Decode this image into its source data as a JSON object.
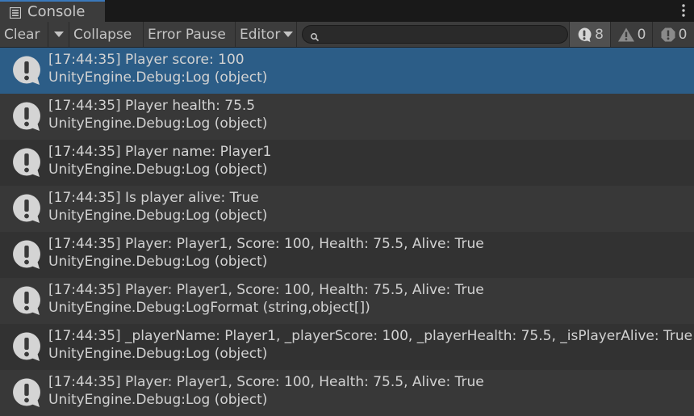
{
  "tab": {
    "label": "Console",
    "icon": "console-list-icon"
  },
  "toolbar": {
    "clear_label": "Clear",
    "collapse_label": "Collapse",
    "error_pause_label": "Error Pause",
    "editor_label": "Editor",
    "search_value": "",
    "counts": {
      "info": "8",
      "warning": "0",
      "error": "0"
    }
  },
  "logs": [
    {
      "line1": "[17:44:35] Player score: 100",
      "line2": "UnityEngine.Debug:Log (object)"
    },
    {
      "line1": "[17:44:35] Player health: 75.5",
      "line2": "UnityEngine.Debug:Log (object)"
    },
    {
      "line1": "[17:44:35] Player name: Player1",
      "line2": "UnityEngine.Debug:Log (object)"
    },
    {
      "line1": "[17:44:35] Is player alive: True",
      "line2": "UnityEngine.Debug:Log (object)"
    },
    {
      "line1": "[17:44:35] Player: Player1, Score: 100, Health: 75.5, Alive: True",
      "line2": "UnityEngine.Debug:Log (object)"
    },
    {
      "line1": "[17:44:35] Player: Player1, Score: 100, Health: 75.5, Alive: True",
      "line2": "UnityEngine.Debug:LogFormat (string,object[])"
    },
    {
      "line1": "[17:44:35] _playerName: Player1, _playerScore: 100, _playerHealth: 75.5, _isPlayerAlive: True",
      "line2": "UnityEngine.Debug:Log (object)"
    },
    {
      "line1": "[17:44:35] Player: Player1, Score: 100, Health: 75.5, Alive: True",
      "line2": "UnityEngine.Debug:Log (object)"
    }
  ],
  "colors": {
    "selected_row": "#2c5d87",
    "row_even": "#383838",
    "row_odd": "#323232",
    "toolbar": "#3c3c3c",
    "accent": "#3a79bb"
  }
}
